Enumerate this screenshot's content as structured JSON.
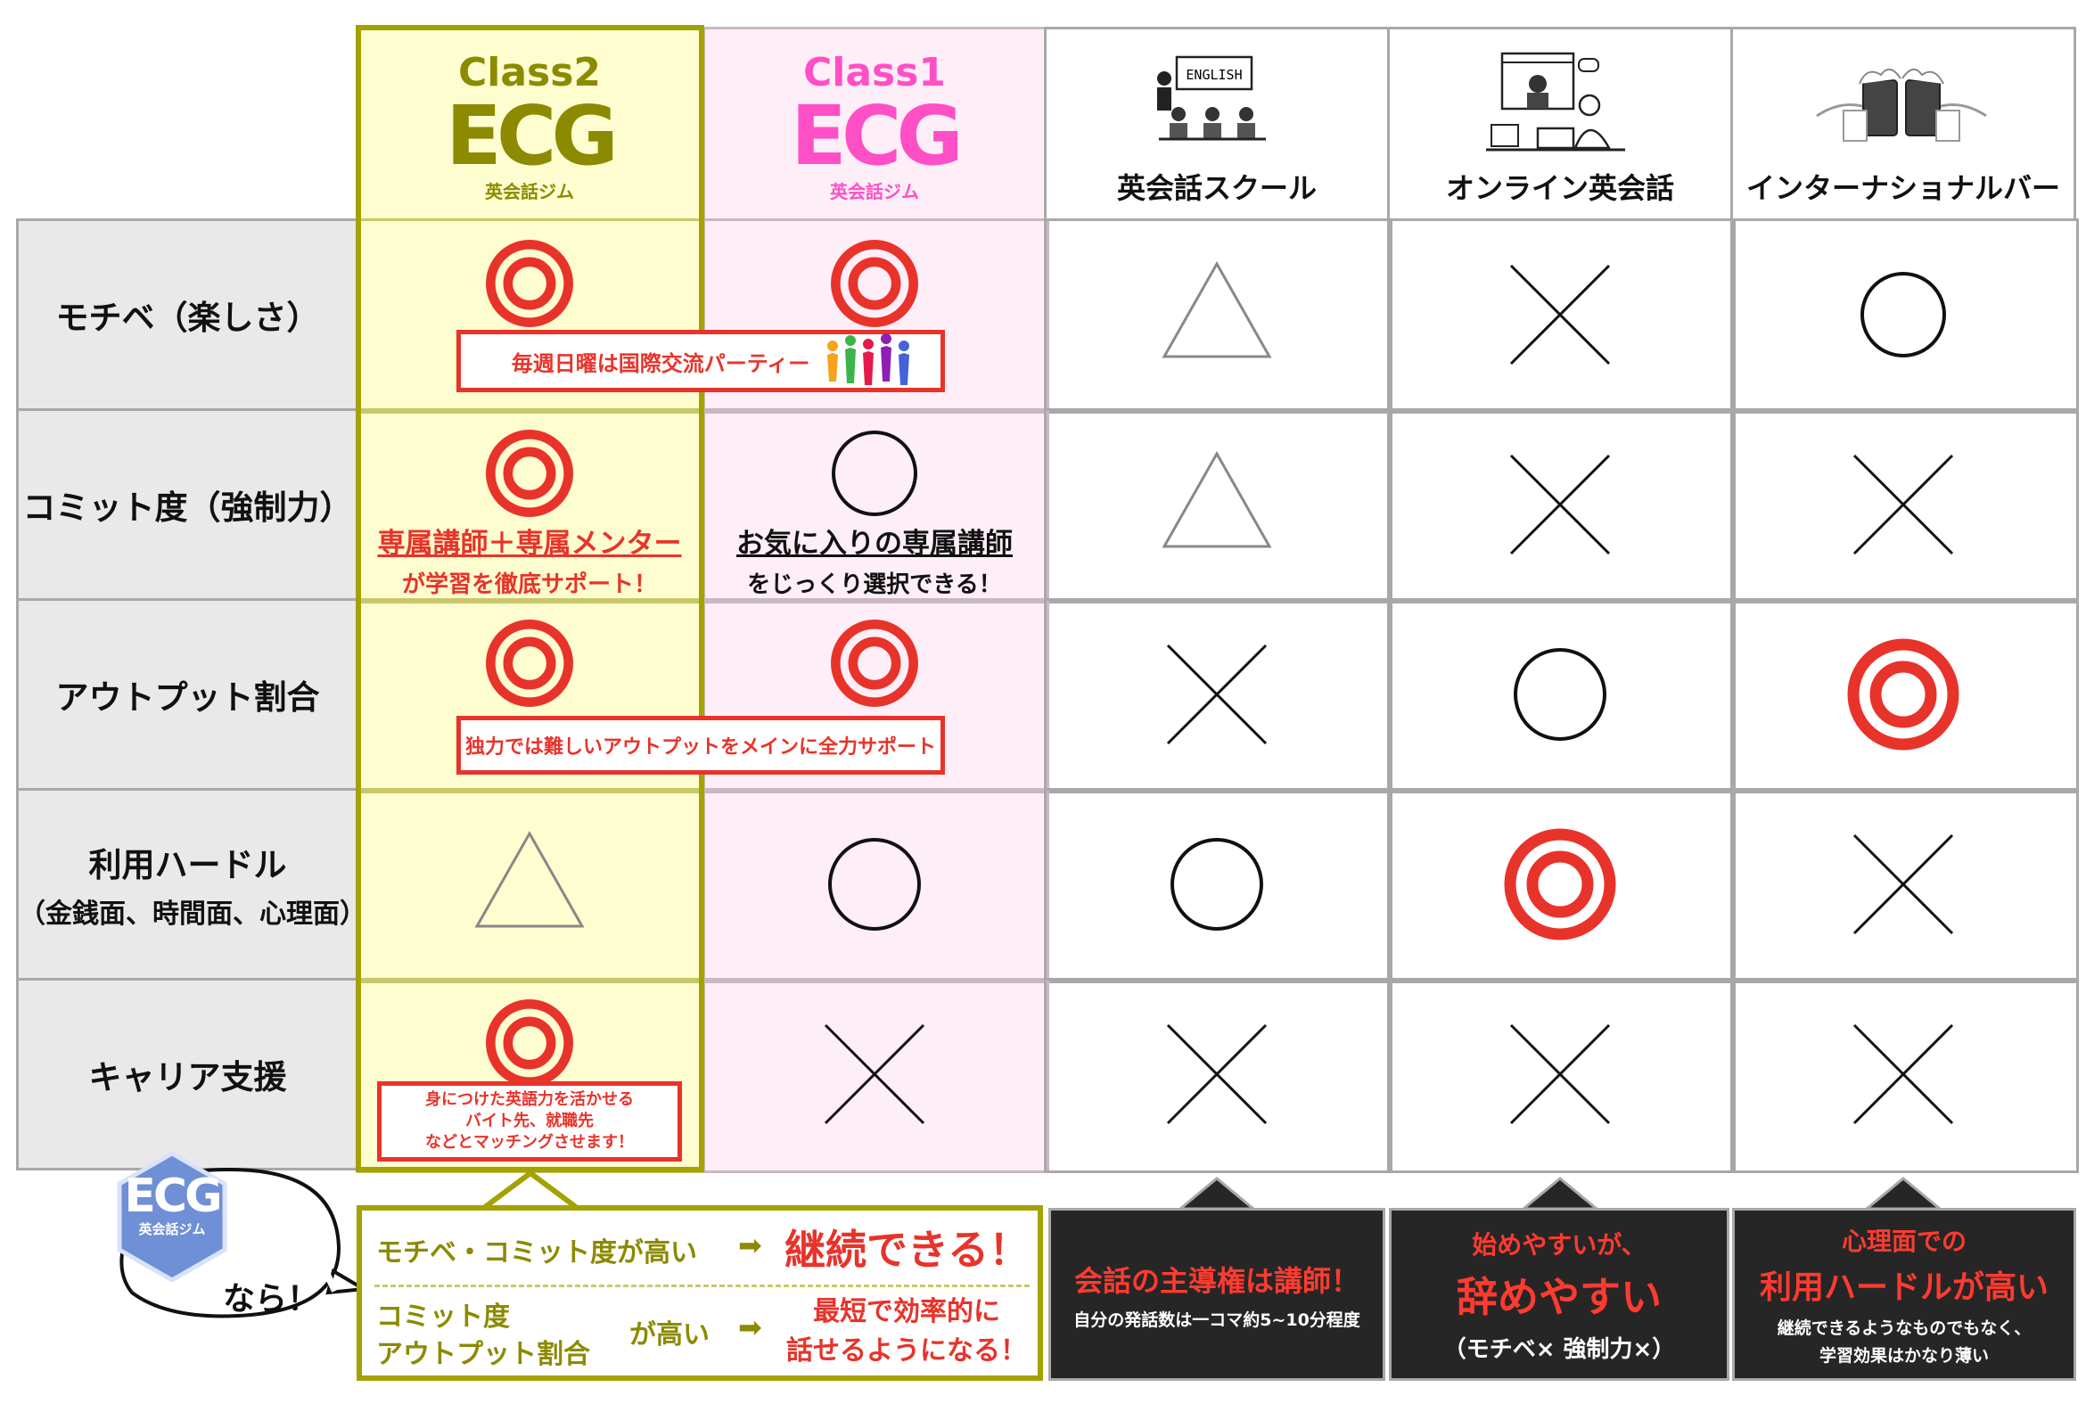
{
  "colors": {
    "class2_bg": "#fdfdcf",
    "class2_border": "#a3a200",
    "class1_bg": "#fdeef7",
    "class1_accent": "#ff4fc6",
    "red": "#e8332a",
    "olive": "#8c8a00",
    "dark": "#262626"
  },
  "header": {
    "class2": {
      "class_label": "Class2",
      "logo_mark": "ECG",
      "logo_jp": "英会話ジム"
    },
    "class1": {
      "class_label": "Class1",
      "logo_mark": "ECG",
      "logo_jp": "英会話ジム"
    },
    "school": {
      "label": "英会話スクール",
      "illustration_text": "ENGLISH"
    },
    "online": {
      "label": "オンライン英会話"
    },
    "bar": {
      "label": "インターナショナルバー"
    }
  },
  "rows": [
    {
      "label": "モチベ（楽しさ）",
      "sublabel": "",
      "ratings": [
        "double-circle",
        "double-circle",
        "triangle",
        "cross",
        "circle"
      ]
    },
    {
      "label": "コミット度（強制力）",
      "sublabel": "",
      "ratings": [
        "double-circle",
        "circle",
        "triangle",
        "cross",
        "cross"
      ]
    },
    {
      "label": "アウトプット割合",
      "sublabel": "",
      "ratings": [
        "double-circle",
        "double-circle",
        "cross",
        "circle",
        "double-circle"
      ]
    },
    {
      "label": "利用ハードル",
      "sublabel": "（金銭面、時間面、心理面）",
      "ratings": [
        "triangle",
        "circle",
        "circle",
        "double-circle",
        "cross"
      ]
    },
    {
      "label": "キャリア支援",
      "sublabel": "",
      "ratings": [
        "double-circle",
        "cross",
        "cross",
        "cross",
        "cross"
      ]
    }
  ],
  "callouts": {
    "party": "毎週日曜は国際交流パーティー",
    "commit_class2_line1": "専属講師＋専属メンター",
    "commit_class2_line2": "が学習を徹底サポート！",
    "commit_class1_line1": "お気に入りの専属講師",
    "commit_class1_line2": "をじっくり選択できる！",
    "output": "独力では難しいアウトプットをメインに全力サポート",
    "career_line1": "身につけた英語力を活かせる",
    "career_line2": "バイト先、就職先",
    "career_line3": "などとマッチングさせます！"
  },
  "footer": {
    "bubble": {
      "logo_mark": "ECG",
      "logo_jp": "英会話ジム",
      "text": "なら！"
    },
    "summary": {
      "line1_left": "モチベ・コミット度が高い",
      "arrow": "➡",
      "line1_right": "継続できる！",
      "line2_left_a": "コミット度",
      "line2_left_b": "アウトプット割合",
      "line2_mid": "が高い",
      "line2_right_a": "最短で効率的に",
      "line2_right_b": "話せるようになる！"
    },
    "school_box": {
      "title": "会話の主導権は講師！",
      "sub": "自分の発話数は一コマ約5~10分程度"
    },
    "online_box": {
      "line1": "始めやすいが、",
      "big": "辞めやすい",
      "line3": "（モチベ× 強制力×）"
    },
    "bar_box": {
      "line1": "心理面での",
      "big": "利用ハードルが高い",
      "line3": "継続できるようなものでもなく、",
      "line4": "学習効果はかなり薄い"
    }
  }
}
